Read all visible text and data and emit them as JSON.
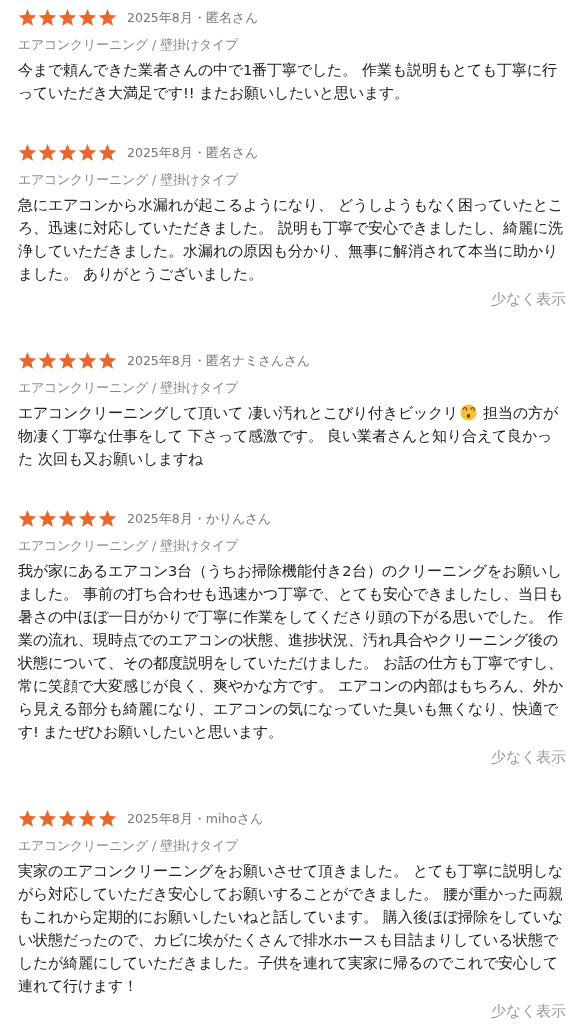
{
  "reviews": [
    {
      "stars": 5,
      "meta": "2025年8月・匿名さん",
      "category": "エアコンクリーニング / 壁掛けタイプ",
      "body": [
        {
          "kind": "text",
          "text": "今まで頼んできた業者さんの中で1番丁寧でした。 作業も説明もとても丁寧に行っていただき大満足です!! またお願いしたいと思います。"
        }
      ]
    },
    {
      "stars": 5,
      "meta": "2025年8月・匿名さん",
      "category": "エアコンクリーニング / 壁掛けタイプ",
      "body": [
        {
          "kind": "text",
          "text": "急にエアコンから水漏れが起こるようになり、 どうしようもなく困っていたところ、迅速に対応していただきました。 説明も丁寧で安心できましたし、綺麗に洗浄していただきました。水漏れの原因も分かり、無事に解消されて本当に助かりました。 ありがとうございました。"
        }
      ],
      "toggle": "少なく表示"
    },
    {
      "stars": 5,
      "meta": "2025年8月・匿名ナミさんさん",
      "category": "エアコンクリーニング / 壁掛けタイプ",
      "body": [
        {
          "kind": "text",
          "text": "エアコンクリーニングして頂いて 凄い汚れとこびり付きビックリ"
        },
        {
          "kind": "emoji"
        },
        {
          "kind": "text",
          "text": " 担当の方が物凄く丁寧な仕事をして 下さって感激です。 良い業者さんと知り合えて良かった 次回も又お願いしますね"
        }
      ]
    },
    {
      "stars": 5,
      "meta": "2025年8月・かりんさん",
      "category": "エアコンクリーニング / 壁掛けタイプ",
      "body": [
        {
          "kind": "text",
          "text": "我が家にあるエアコン3台（うちお掃除機能付き2台）のクリーニングをお願いしました。 事前の打ち合わせも迅速かつ丁寧で、とても安心できましたし、当日も暑さの中ほぼ一日がかりで丁寧に作業をしてくださり頭の下がる思いでした。 作業の流れ、現時点でのエアコンの状態、進捗状況、汚れ具合やクリーニング後の状態について、その都度説明をしていただけました。 お話の仕方も丁寧ですし、常に笑顔で大変感じが良く、爽やかな方です。 エアコンの内部はもちろん、外から見える部分も綺麗になり、エアコンの気になっていた臭いも無くなり、快適です! またぜひお願いしたいと思います。"
        }
      ],
      "toggle": "少なく表示"
    },
    {
      "stars": 5,
      "meta": "2025年8月・mihoさん",
      "category": "エアコンクリーニング / 壁掛けタイプ",
      "body": [
        {
          "kind": "text",
          "text": "実家のエアコンクリーニングをお願いさせて頂きました。 とても丁寧に説明しながら対応していただき安心してお願いすることができました。 腰が重かった両親もこれから定期的にお願いしたいねと話しています。 購入後ほぼ掃除をしていない状態だったので、カビに埃がたくさんで排水ホースも目詰まりしている状態でしたが綺麗にしていただきました。子供を連れて実家に帰るのでこれで安心して連れて行けます！"
        }
      ],
      "toggle": "少なく表示"
    }
  ]
}
